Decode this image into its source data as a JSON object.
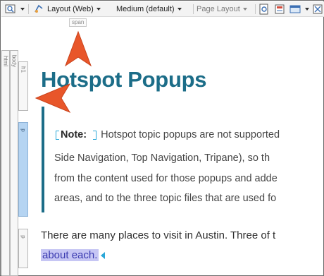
{
  "toolbar": {
    "layout_label": "Layout (Web)",
    "medium_label": "Medium (default)",
    "page_layout_label": "Page Layout"
  },
  "span_tag": "span",
  "structure_bars": {
    "html": "html",
    "body": "body",
    "h1": "h1",
    "p_selected": "p",
    "p_lower": "p"
  },
  "heading": "Hotspot Popups",
  "note": {
    "label": "Note:",
    "line1_text": "Hotspot topic popups are not supported",
    "line2_text": "Side Navigation, Top Navigation, Tripane), so th",
    "line3_text": "from the content used for those popups and adde",
    "line4_text": "areas, and to the three topic files that are used fo"
  },
  "paragraph": {
    "line1": "There are many places to visit in Austin. Three of t",
    "line2_highlight": "about each."
  },
  "colors": {
    "heading": "#1c6d88",
    "arrow": "#e8562a",
    "tag_marker": "#2aa7d8",
    "selection": "#c6c6f4"
  },
  "icons": {
    "view": "view-icon",
    "layout": "layout-icon",
    "tb_right_1": "preview-icon",
    "tb_right_2": "print-icon",
    "tb_right_3": "window-icon",
    "tb_right_4": "structure-icon"
  }
}
